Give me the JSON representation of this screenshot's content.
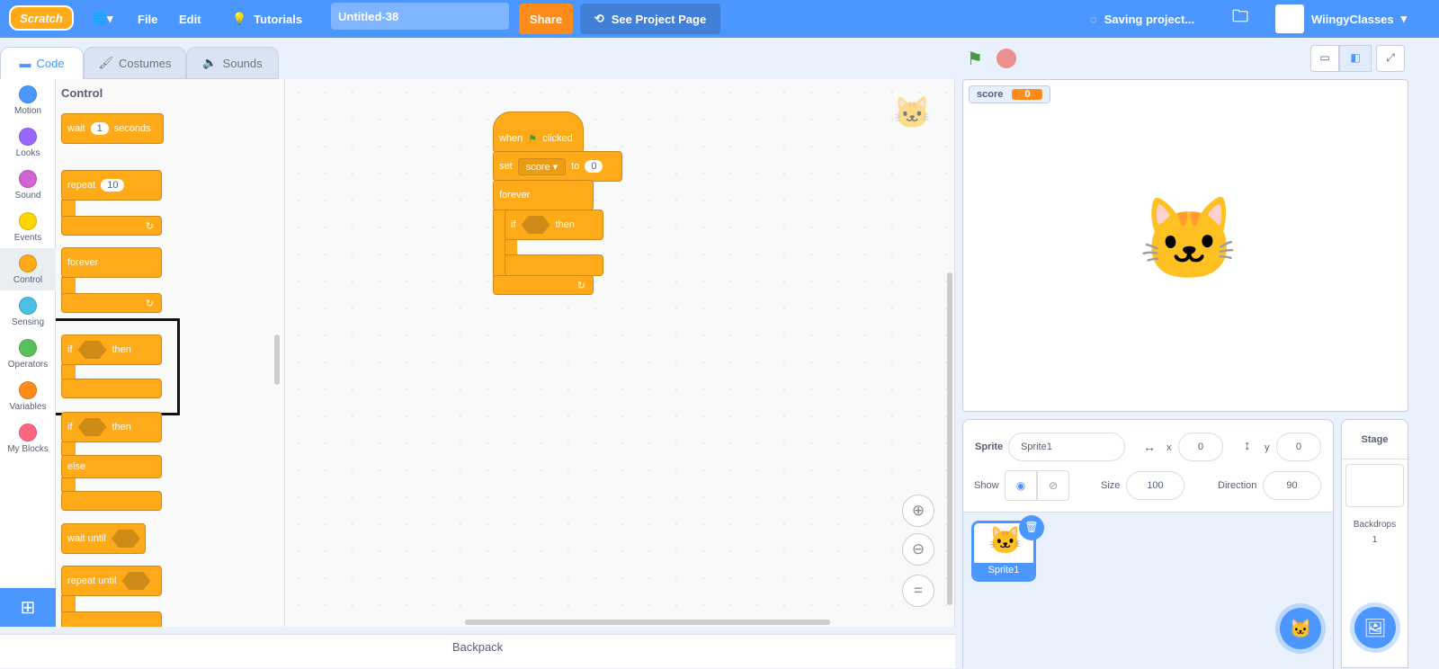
{
  "header": {
    "logo": "Scratch",
    "file": "File",
    "edit": "Edit",
    "tutorials": "Tutorials",
    "project_title": "Untitled-38",
    "share": "Share",
    "see_project_page": "See Project Page",
    "saving": "Saving project...",
    "username": "WiingyClasses"
  },
  "tabs": [
    {
      "label": "Code"
    },
    {
      "label": "Costumes"
    },
    {
      "label": "Sounds"
    }
  ],
  "categories": [
    {
      "label": "Motion",
      "color": "#4c97ff"
    },
    {
      "label": "Looks",
      "color": "#9966ff"
    },
    {
      "label": "Sound",
      "color": "#cf63cf"
    },
    {
      "label": "Events",
      "color": "#ffd500"
    },
    {
      "label": "Control",
      "color": "#ffab19"
    },
    {
      "label": "Sensing",
      "color": "#4cbfe6"
    },
    {
      "label": "Operators",
      "color": "#59c059"
    },
    {
      "label": "Variables",
      "color": "#ff8c1a"
    },
    {
      "label": "My Blocks",
      "color": "#ff6680"
    }
  ],
  "palette": {
    "heading": "Control",
    "wait": "wait",
    "wait_val": "1",
    "seconds": "seconds",
    "repeat": "repeat",
    "repeat_val": "10",
    "forever": "forever",
    "if": "if",
    "then": "then",
    "else": "else",
    "wait_until": "wait until",
    "repeat_until": "repeat until"
  },
  "script": {
    "when": "when",
    "clicked": "clicked",
    "set": "set",
    "var": "score ▾",
    "to": "to",
    "set_val": "0",
    "forever": "forever",
    "if": "if",
    "then": "then"
  },
  "backpack": "Backpack",
  "stage": {
    "monitor_label": "score",
    "monitor_value": "0"
  },
  "sprite": {
    "sprite_label": "Sprite",
    "name": "Sprite1",
    "x_label": "x",
    "x": "0",
    "y_label": "y",
    "y": "0",
    "show_label": "Show",
    "size_label": "Size",
    "size": "100",
    "direction_label": "Direction",
    "direction": "90",
    "thumb_name": "Sprite1"
  },
  "stage_pane": {
    "title": "Stage",
    "backdrops_label": "Backdrops",
    "backdrops": "1"
  },
  "colors": {
    "header": "#4c97ff",
    "control": "#ffab19",
    "share": "#ff8c1a"
  }
}
